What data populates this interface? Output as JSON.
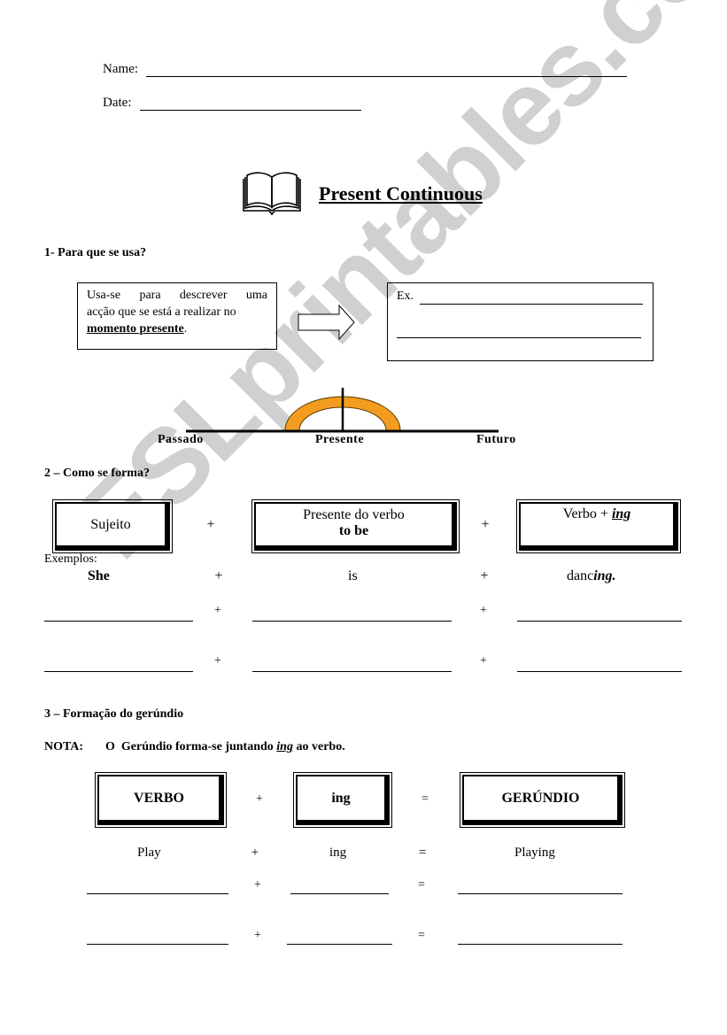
{
  "header": {
    "name_label": "Name:",
    "date_label": "Date:"
  },
  "title": {
    "icon": "open-book-icon",
    "text": "Present Continuous"
  },
  "section1": {
    "heading": "1- Para que se usa?",
    "definition_line1": "Usa-se para descrever uma",
    "definition_line2": "acção que se está a realizar no",
    "definition_emphasis": "momento presente",
    "definition_end": ".",
    "arrow_icon": "right-arrow-icon",
    "example_label": "Ex."
  },
  "timeline": {
    "labels": [
      "Passado",
      "Presente",
      "Futuro"
    ],
    "arc_color": "#f39c1f"
  },
  "section2": {
    "heading_num": "2",
    "heading_text": " – Como se forma?",
    "boxes": {
      "subject": "Sujeito",
      "to_be_line1": "Presente do verbo",
      "to_be_line2": "to be",
      "verb_prefix": "Verbo + ",
      "verb_suffix": "ing"
    },
    "plus": "+",
    "examples_label": "Exemplos:",
    "example": {
      "subject": "She",
      "aux": "is",
      "verb_stem": "danc",
      "verb_ending": "ing."
    }
  },
  "section3": {
    "heading": "3 – Formação do gerúndio",
    "note_label": "NOTA:",
    "note_text_before": "O  Gerúndio forma-se juntando ",
    "note_emphasis": "ing",
    "note_text_after": " ao verbo.",
    "boxes": {
      "verb": "VERBO",
      "ing": "ing",
      "gerund": "GERÚNDIO"
    },
    "plus": "+",
    "equals": "=",
    "example": {
      "verb": "Play",
      "ing": "ing",
      "gerund": "Playing"
    }
  },
  "watermark": "ESLprintables.com"
}
